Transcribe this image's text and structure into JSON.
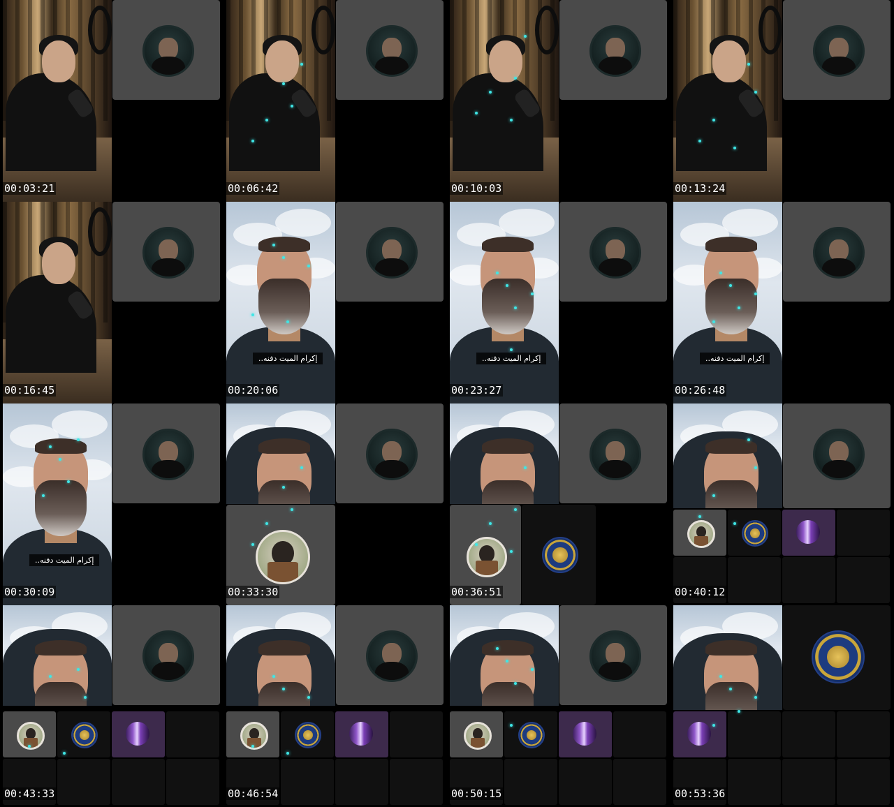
{
  "frames": [
    {
      "timestamp": "00:03:21",
      "scene": "studio",
      "layout": "a"
    },
    {
      "timestamp": "00:06:42",
      "scene": "studio",
      "layout": "a"
    },
    {
      "timestamp": "00:10:03",
      "scene": "studio",
      "layout": "a"
    },
    {
      "timestamp": "00:13:24",
      "scene": "studio",
      "layout": "a"
    },
    {
      "timestamp": "00:16:45",
      "scene": "studio",
      "layout": "a"
    },
    {
      "timestamp": "00:20:06",
      "scene": "sky",
      "layout": "a",
      "caption": "إكرام الميت دفنه.."
    },
    {
      "timestamp": "00:23:27",
      "scene": "sky",
      "layout": "a",
      "caption": "إكرام الميت دفنه.."
    },
    {
      "timestamp": "00:26:48",
      "scene": "sky",
      "layout": "a",
      "caption": "إكرام الميت دفنه.."
    },
    {
      "timestamp": "00:30:09",
      "scene": "sky",
      "layout": "a",
      "caption": "إكرام الميت دفنه.."
    },
    {
      "timestamp": "00:33:30",
      "scene": "sky",
      "layout": "b"
    },
    {
      "timestamp": "00:36:51",
      "scene": "sky",
      "layout": "c"
    },
    {
      "timestamp": "00:40:12",
      "scene": "sky",
      "layout": "d"
    },
    {
      "timestamp": "00:43:33",
      "scene": "sky",
      "layout": "e"
    },
    {
      "timestamp": "00:46:54",
      "scene": "sky",
      "layout": "e"
    },
    {
      "timestamp": "00:50:15",
      "scene": "sky",
      "layout": "e"
    },
    {
      "timestamp": "00:53:36",
      "scene": "sky",
      "layout": "f"
    }
  ],
  "colors": {
    "background": "#000000",
    "tile": "#4a4a4a",
    "spark": "#3fe6e6"
  },
  "icons": [
    "cohost-avatar-man",
    "cohost-avatar-woman",
    "channel-logo-icon",
    "purple-avatar"
  ]
}
